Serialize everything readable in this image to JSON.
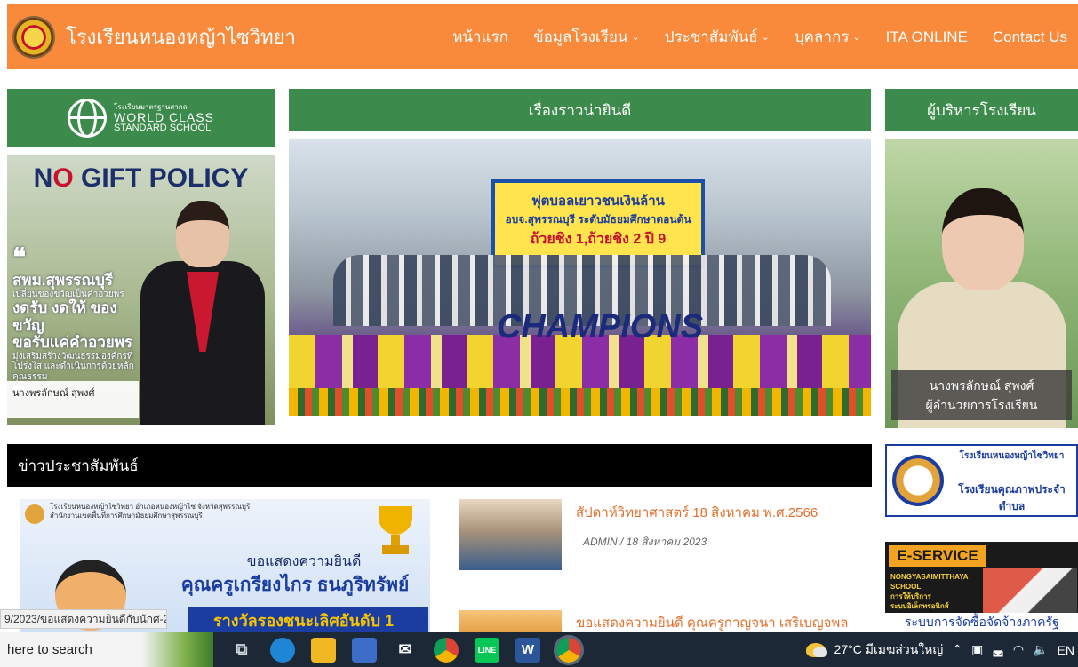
{
  "header": {
    "title": "โรงเรียนหนองหญ้าไซวิทยา",
    "nav": [
      {
        "label": "หน้าแรก",
        "dropdown": false
      },
      {
        "label": "ข้อมูลโรงเรียน",
        "dropdown": true
      },
      {
        "label": "ประชาสัมพันธ์",
        "dropdown": true
      },
      {
        "label": "บุคลากร",
        "dropdown": true
      },
      {
        "label": "ITA ONLINE",
        "dropdown": false
      },
      {
        "label": "Contact Us",
        "dropdown": false
      }
    ],
    "color": "#f98a3c"
  },
  "left": {
    "wcs_small": "โรงเรียนมาตรฐานสากล",
    "wcs_line1": "WORLD CLASS",
    "wcs_line2": "STANDARD SCHOOL",
    "gift_title_prefix": "N",
    "gift_title_o": "O",
    "gift_title_rest": " GIFT POLICY",
    "gift_quote_open": "❝",
    "gift_org": "สพม.สุพรรณบุรี",
    "gift_sub1": "เปลี่ยนของขวัญเป็นคำอวยพร",
    "gift_line1": "งดรับ งดให้ ของขวัญ",
    "gift_line2": "ขอรับแค่คำอวยพร",
    "gift_sub2": "มุ่งเสริมสร้างวัฒนธรรมองค์กรที่โปร่งใส และดำเนินการด้วยหลักคุณธรรม",
    "gift_quote_close": "❞",
    "gift_sign": "นางพรลักษณ์ สุพงศ์"
  },
  "middle": {
    "title": "เรื่องราวน่ายินดี",
    "banner_l1": "ฟุตบอลเยาวชนเงินล้าน",
    "banner_l2": "อบจ.สุพรรณบุรี ระดับมัธยมศึกษาตอนต้น",
    "banner_l3": "ถ้วยชิง 1,ถ้วยชิง 2 ปี 9",
    "champions": "CHAMPIONS"
  },
  "right": {
    "title": "ผู้บริหารโรงเรียน",
    "name": "นางพรลักษณ์ สุพงศ์",
    "position": "ผู้อำนวยการโรงเรียน"
  },
  "news": {
    "title": "ข่าวประชาสัมพันธ์",
    "feature": {
      "school_line1": "โรงเรียนหนองหญ้าไซวิทยา อำเภอหนองหญ้าไซ จังหวัดสุพรรณบุรี",
      "school_line2": "สำนักงานเขตพื้นที่การศึกษามัธยมศึกษาสุพรรณบุรี",
      "congrats": "ขอแสดงความยินดี",
      "name": "คุณครูเกรียงไกร ธนภูริทรัพย์",
      "award": "รางวัลรองชนะเลิศอันดับ 1"
    },
    "items": [
      {
        "title": "สัปดาห์วิทยาศาสตร์ 18 สิงหาคม พ.ศ.2566",
        "meta": "ADMIN  /  18 สิงหาคม 2023"
      },
      {
        "title": "ขอแสดงความยินดี คุณครูกาญจนา เสริเบญจพล",
        "meta": ""
      }
    ]
  },
  "sidebar": {
    "quality_top": "โรงเรียนหนองหญ้าไซวิทยา",
    "quality_mid": "โรงเรียนคุณภาพประจำตำบล",
    "eservice": "E-SERVICE",
    "eservice_sub1": "NONGYASAIMITTHAYA",
    "eservice_sub2": "SCHOOL",
    "eservice_sub3": "การให้บริการ",
    "eservice_sub4": "ระบบอิเล็กทรอนิกส์",
    "procure": "ระบบการจัดซื้อจัดจ้างภาครัฐ"
  },
  "status_url": "9/2023/ขอแสดงความยินดีกับนักศ-2/",
  "taskbar": {
    "search_placeholder": "here to search",
    "weather": "27°C  มีเมฆส่วนใหญ่",
    "lang": "EN"
  }
}
